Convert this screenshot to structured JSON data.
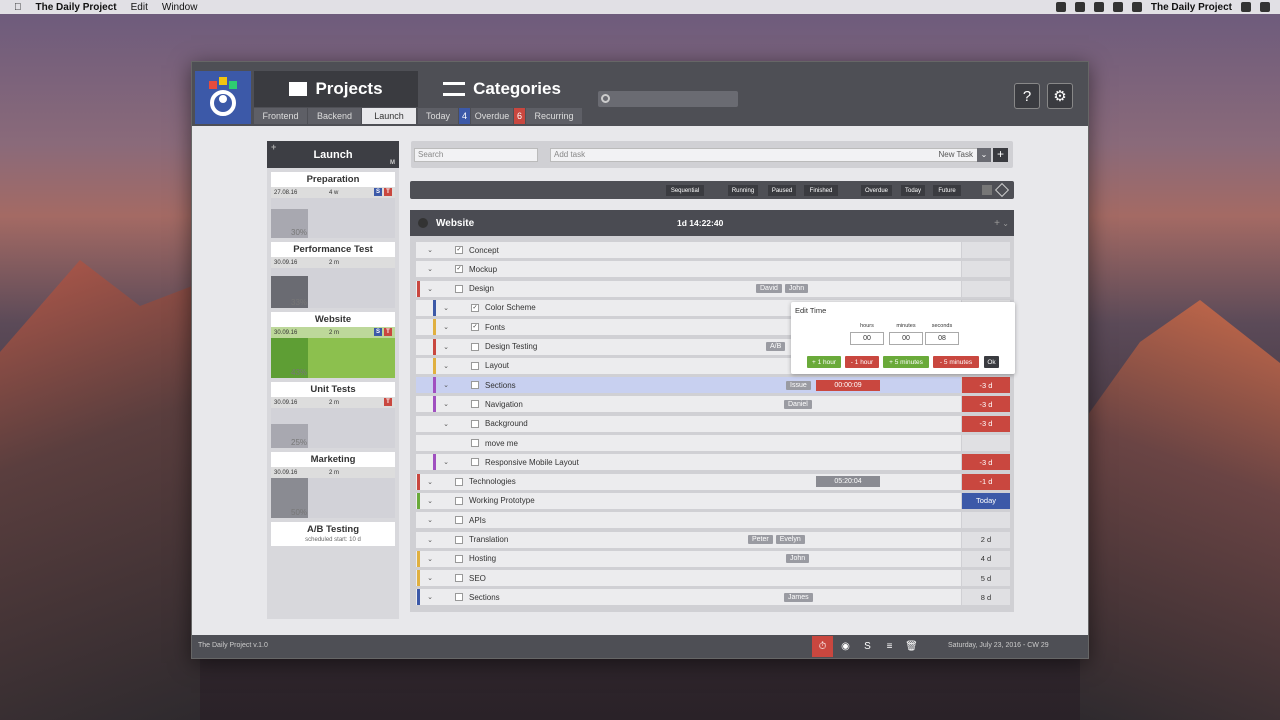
{
  "menubar": {
    "app": "The Daily Project",
    "items": [
      "Edit",
      "Window"
    ],
    "right_app": "The Daily Project"
  },
  "header": {
    "tabs": [
      {
        "label": "Projects",
        "active": true
      },
      {
        "label": "Categories",
        "active": false
      }
    ],
    "project_subtabs": [
      "Frontend",
      "Backend",
      "Launch"
    ],
    "category_subtabs": {
      "today": "Today",
      "today_count": "4",
      "overdue": "Overdue",
      "overdue_count": "6",
      "recurring": "Recurring"
    },
    "help_label": "?"
  },
  "sidebar": {
    "title": "Launch",
    "projects": [
      {
        "name": "Preparation",
        "date": "27.08.16",
        "duration": "4 w",
        "percent": "30%",
        "progress": 0.3,
        "flags": [
          "S",
          "T"
        ]
      },
      {
        "name": "Performance Test",
        "date": "30.09.16",
        "duration": "2 m",
        "percent": "33%",
        "progress": 0.33,
        "flags": []
      },
      {
        "name": "Website",
        "date": "30.09.16",
        "duration": "2 m",
        "percent": "43%",
        "progress": 0.43,
        "flags": [
          "S",
          "T"
        ]
      },
      {
        "name": "Unit Tests",
        "date": "30.09.16",
        "duration": "2 m",
        "percent": "25%",
        "progress": 0.25,
        "flags": [
          "T"
        ]
      },
      {
        "name": "Marketing",
        "date": "30.09.16",
        "duration": "2 m",
        "percent": "50%",
        "progress": 0.5,
        "flags": []
      },
      {
        "name": "A/B Testing",
        "subtitle": "scheduled start: 10 d"
      }
    ]
  },
  "toolbar": {
    "search_placeholder": "Search",
    "add_task_placeholder": "Add task",
    "new_task_label": "New Task"
  },
  "filters": [
    "Sequential",
    "Running",
    "Paused",
    "Finished",
    "Overdue",
    "Today",
    "Future"
  ],
  "project": {
    "title": "Website",
    "timer": "1d 14:22:40"
  },
  "tasks": [
    {
      "name": "Concept",
      "checked": true,
      "tags": [],
      "due": ""
    },
    {
      "name": "Mockup",
      "checked": true,
      "tags": [],
      "due": ""
    },
    {
      "name": "Design",
      "checked": false,
      "tags": [
        "David",
        "John"
      ],
      "due": ""
    },
    {
      "name": "Color Scheme",
      "checked": true,
      "tags": [],
      "due": ""
    },
    {
      "name": "Fonts",
      "checked": true,
      "tags": [],
      "due": ""
    },
    {
      "name": "Design Testing",
      "checked": false,
      "tags": [
        "A/B"
      ],
      "due": ""
    },
    {
      "name": "Layout",
      "checked": false,
      "tags": [],
      "due": ""
    },
    {
      "name": "Sections",
      "checked": false,
      "tags": [
        "Issue"
      ],
      "timer": "00:00:09",
      "due": "-3 d"
    },
    {
      "name": "Navigation",
      "checked": false,
      "tags": [
        "Daniel"
      ],
      "due": "-3 d"
    },
    {
      "name": "Background",
      "checked": false,
      "tags": [],
      "due": "-3 d"
    },
    {
      "name": "move me",
      "checked": false,
      "tags": [],
      "due": ""
    },
    {
      "name": "Responsive Mobile Layout",
      "checked": false,
      "tags": [],
      "due": "-3 d"
    },
    {
      "name": "Technologies",
      "checked": false,
      "tags": [],
      "timer": "05:20:04",
      "due": "-1 d"
    },
    {
      "name": "Working Prototype",
      "checked": false,
      "tags": [],
      "due": "Today"
    },
    {
      "name": "APIs",
      "checked": false,
      "tags": [],
      "due": ""
    },
    {
      "name": "Translation",
      "checked": false,
      "tags": [
        "Peter",
        "Evelyn"
      ],
      "due": "2 d"
    },
    {
      "name": "Hosting",
      "checked": false,
      "tags": [
        "John"
      ],
      "due": "4 d"
    },
    {
      "name": "SEO",
      "checked": false,
      "tags": [],
      "due": "5 d"
    },
    {
      "name": "Sections",
      "checked": false,
      "tags": [
        "James"
      ],
      "due": "8 d"
    }
  ],
  "edit_time": {
    "title": "Edit Time",
    "hours_label": "hours",
    "minutes_label": "minutes",
    "seconds_label": "seconds",
    "hours": "00",
    "minutes": "00",
    "seconds": "08",
    "buttons": [
      "+ 1 hour",
      "- 1 hour",
      "+ 5 minutes",
      "- 5 minutes",
      "Ok"
    ]
  },
  "status": {
    "version": "The Daily Project v.1.0",
    "date": "Saturday, July 23, 2016 - CW 29"
  },
  "colors": {
    "accent": "#3c59a8",
    "overdue": "#c9473f",
    "today": "#3c59a8",
    "green": "#6aaa3a"
  }
}
